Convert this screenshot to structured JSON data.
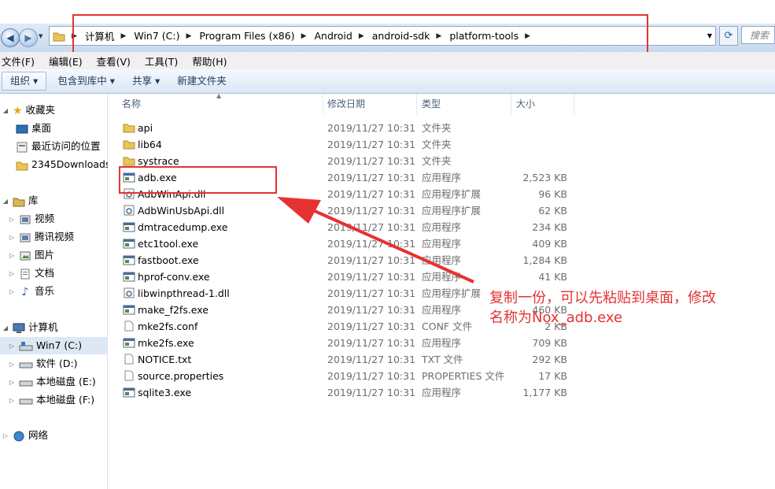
{
  "address": {
    "crumbs": [
      "计算机",
      "Win7 (C:)",
      "Program Files (x86)",
      "Android",
      "android-sdk",
      "platform-tools"
    ],
    "search_placeholder": "搜索"
  },
  "menu": [
    "文件(F)",
    "编辑(E)",
    "查看(V)",
    "工具(T)",
    "帮助(H)"
  ],
  "commands": [
    "组织 ▾",
    "包含到库中 ▾",
    "共享 ▾",
    "新建文件夹"
  ],
  "nav": {
    "favorites": {
      "label": "收藏夹",
      "items": [
        "桌面",
        "最近访问的位置",
        "2345Downloads"
      ]
    },
    "libraries": {
      "label": "库",
      "items": [
        "视频",
        "腾讯视频",
        "图片",
        "文档",
        "音乐"
      ]
    },
    "computer": {
      "label": "计算机",
      "items": [
        "Win7 (C:)",
        "软件 (D:)",
        "本地磁盘 (E:)",
        "本地磁盘 (F:)"
      ]
    },
    "network": {
      "label": "网络"
    }
  },
  "columns": [
    "名称",
    "修改日期",
    "类型",
    "大小"
  ],
  "files": [
    {
      "name": "api",
      "date": "2019/11/27 10:31",
      "type": "文件夹",
      "size": "",
      "icon": "folder-icon"
    },
    {
      "name": "lib64",
      "date": "2019/11/27 10:31",
      "type": "文件夹",
      "size": "",
      "icon": "folder-icon"
    },
    {
      "name": "systrace",
      "date": "2019/11/27 10:31",
      "type": "文件夹",
      "size": "",
      "icon": "folder-icon"
    },
    {
      "name": "adb.exe",
      "date": "2019/11/27 10:31",
      "type": "应用程序",
      "size": "2,523 KB",
      "icon": "exe-icon"
    },
    {
      "name": "AdbWinApi.dll",
      "date": "2019/11/27 10:31",
      "type": "应用程序扩展",
      "size": "96 KB",
      "icon": "dll-icon"
    },
    {
      "name": "AdbWinUsbApi.dll",
      "date": "2019/11/27 10:31",
      "type": "应用程序扩展",
      "size": "62 KB",
      "icon": "dll-icon"
    },
    {
      "name": "dmtracedump.exe",
      "date": "2019/11/27 10:31",
      "type": "应用程序",
      "size": "234 KB",
      "icon": "exe-icon"
    },
    {
      "name": "etc1tool.exe",
      "date": "2019/11/27 10:31",
      "type": "应用程序",
      "size": "409 KB",
      "icon": "exe-icon"
    },
    {
      "name": "fastboot.exe",
      "date": "2019/11/27 10:31",
      "type": "应用程序",
      "size": "1,284 KB",
      "icon": "exe-icon"
    },
    {
      "name": "hprof-conv.exe",
      "date": "2019/11/27 10:31",
      "type": "应用程序",
      "size": "41 KB",
      "icon": "exe-icon"
    },
    {
      "name": "libwinpthread-1.dll",
      "date": "2019/11/27 10:31",
      "type": "应用程序扩展",
      "size": "",
      "icon": "dll-icon"
    },
    {
      "name": "make_f2fs.exe",
      "date": "2019/11/27 10:31",
      "type": "应用程序",
      "size": "460 KB",
      "icon": "exe-icon"
    },
    {
      "name": "mke2fs.conf",
      "date": "2019/11/27 10:31",
      "type": "CONF 文件",
      "size": "2 KB",
      "icon": "file-icon"
    },
    {
      "name": "mke2fs.exe",
      "date": "2019/11/27 10:31",
      "type": "应用程序",
      "size": "709 KB",
      "icon": "exe-icon"
    },
    {
      "name": "NOTICE.txt",
      "date": "2019/11/27 10:31",
      "type": "TXT 文件",
      "size": "292 KB",
      "icon": "file-icon"
    },
    {
      "name": "source.properties",
      "date": "2019/11/27 10:31",
      "type": "PROPERTIES 文件",
      "size": "17 KB",
      "icon": "file-icon"
    },
    {
      "name": "sqlite3.exe",
      "date": "2019/11/27 10:31",
      "type": "应用程序",
      "size": "1,177 KB",
      "icon": "exe-icon"
    }
  ],
  "annotation": {
    "line1": "复制一份，可以先粘贴到桌面，修改",
    "line2": "名称为Nox_adb.exe"
  },
  "colors": {
    "highlight": "#e63232",
    "selected": "#dde8f5"
  }
}
